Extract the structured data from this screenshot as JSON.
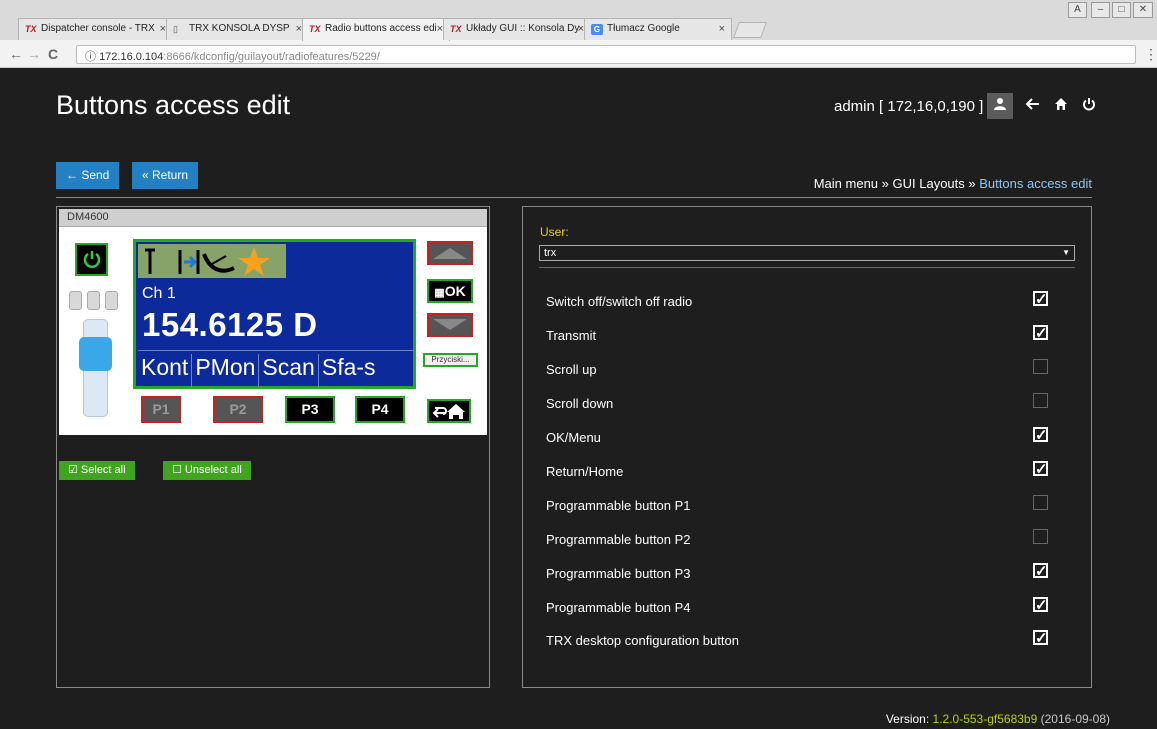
{
  "browser": {
    "tabs": [
      {
        "label": "Dispatcher console - TRX",
        "icon": "trx-logo-icon",
        "fav": "TX"
      },
      {
        "label": "TRX KONSOLA DYSP",
        "icon": "document-icon",
        "fav": "▯"
      },
      {
        "label": "Radio buttons access edi",
        "icon": "trx-logo-icon",
        "fav": "TX"
      },
      {
        "label": "Układy GUI :: Konsola Dy",
        "icon": "trx-logo-icon",
        "fav": "TX"
      },
      {
        "label": "Tłumacz Google",
        "icon": "google-translate-icon",
        "fav": "G"
      }
    ],
    "tab_close": "×",
    "back": "←",
    "forward": "→",
    "reload": "C",
    "info": "ⓘ",
    "url_host": "172.16.0.104",
    "url_path": ":8666/kdconfig/guilayout/radiofeatures/5229/",
    "star": "☆",
    "menu": "⋮",
    "win_user": "A",
    "win_min": "–",
    "win_max": "□",
    "win_close": "✕"
  },
  "header": {
    "title": "Buttons access edit",
    "user_info": "admin [ 172,16,0,190 ]"
  },
  "toolbar": {
    "send_label": "← Send",
    "return_label": "« Return"
  },
  "breadcrumb": {
    "main": "Main menu",
    "sep": "»",
    "layouts": "GUI Layouts",
    "current": "Buttons access edit"
  },
  "radio": {
    "model": "DM4600",
    "channel": "Ch 1",
    "frequency": "154.6125 D",
    "softkeys": [
      "Kont",
      "PMon",
      "Scan",
      "Sfa-s"
    ],
    "ok_label": "OK",
    "przyciski": "Przyciski...",
    "p_buttons": [
      "P1",
      "P2",
      "P3",
      "P4"
    ]
  },
  "select": {
    "select_all": "☑ Select all",
    "unselect_all": "☐ Unselect all"
  },
  "form": {
    "user_label": "User:",
    "user_value": "trx",
    "permissions": [
      {
        "label": "Switch off/switch off radio",
        "checked": true
      },
      {
        "label": "Transmit",
        "checked": true
      },
      {
        "label": "Scroll up",
        "checked": false
      },
      {
        "label": "Scroll down",
        "checked": false
      },
      {
        "label": "OK/Menu",
        "checked": true
      },
      {
        "label": "Return/Home",
        "checked": true
      },
      {
        "label": "Programmable button P1",
        "checked": false
      },
      {
        "label": "Programmable button P2",
        "checked": false
      },
      {
        "label": "Programmable button P3",
        "checked": true
      },
      {
        "label": "Programmable button P4",
        "checked": true
      },
      {
        "label": "TRX desktop configuration button",
        "checked": true
      }
    ]
  },
  "footer": {
    "version_label": "Version:",
    "version": "1.2.0-553-gf5683b9",
    "date": "(2016-09-08)"
  },
  "colors": {
    "accent_blue": "#2280c3",
    "green": "#3fa41e",
    "radio_green_border": "#23a823",
    "radio_red_border": "#cc2020",
    "lcd_blue": "#0d2a9a",
    "user_label_yellow": "#e8d200",
    "version_green": "#b8d200"
  }
}
